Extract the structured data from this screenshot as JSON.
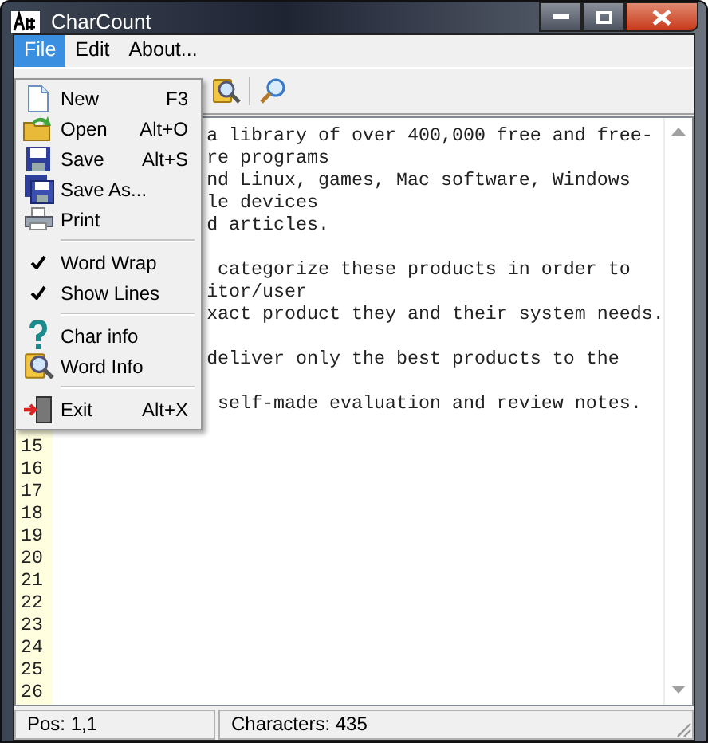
{
  "window": {
    "title": "CharCount"
  },
  "menu_bar": [
    {
      "label": "File",
      "selected": true
    },
    {
      "label": "Edit",
      "selected": false
    },
    {
      "label": "About...",
      "selected": false
    }
  ],
  "file_menu": [
    {
      "kind": "command",
      "label": "New",
      "shortcut": "F3"
    },
    {
      "kind": "command",
      "label": "Open",
      "shortcut": "Alt+O"
    },
    {
      "kind": "command",
      "label": "Save",
      "shortcut": "Alt+S"
    },
    {
      "kind": "command",
      "label": "Save As..."
    },
    {
      "kind": "command",
      "label": "Print"
    },
    {
      "kind": "separator"
    },
    {
      "kind": "check",
      "label": "Word Wrap",
      "checked": true
    },
    {
      "kind": "check",
      "label": "Show Lines",
      "checked": true
    },
    {
      "kind": "separator"
    },
    {
      "kind": "command",
      "label": "Char info"
    },
    {
      "kind": "command",
      "label": "Word Info"
    },
    {
      "kind": "separator"
    },
    {
      "kind": "command",
      "label": "Exit",
      "shortcut": "Alt+X"
    }
  ],
  "editor": {
    "lines": [
      {
        "kind": "text",
        "text": "a library of over 400,000 free and free-"
      },
      {
        "kind": "text",
        "text": "re programs"
      },
      {
        "kind": "text",
        "text": "nd Linux, games, Mac software, Windows"
      },
      {
        "kind": "text",
        "text": "le devices"
      },
      {
        "kind": "text",
        "text": "d articles."
      },
      {
        "kind": "blank"
      },
      {
        "kind": "text",
        "text": " categorize these products in order to"
      },
      {
        "kind": "text",
        "text": "itor/user"
      },
      {
        "kind": "text",
        "text": "xact product they and their system needs."
      },
      {
        "kind": "blank"
      },
      {
        "kind": "text",
        "text": "deliver only the best products to the"
      },
      {
        "kind": "blank"
      },
      {
        "kind": "text",
        "text": " self-made evaluation and review notes."
      }
    ],
    "line_numbers": [
      "15",
      "16",
      "17",
      "18",
      "19",
      "20",
      "21",
      "22",
      "23",
      "24",
      "25",
      "26"
    ]
  },
  "status_bar": [
    "Pos: 1,1",
    "Characters: 435"
  ]
}
